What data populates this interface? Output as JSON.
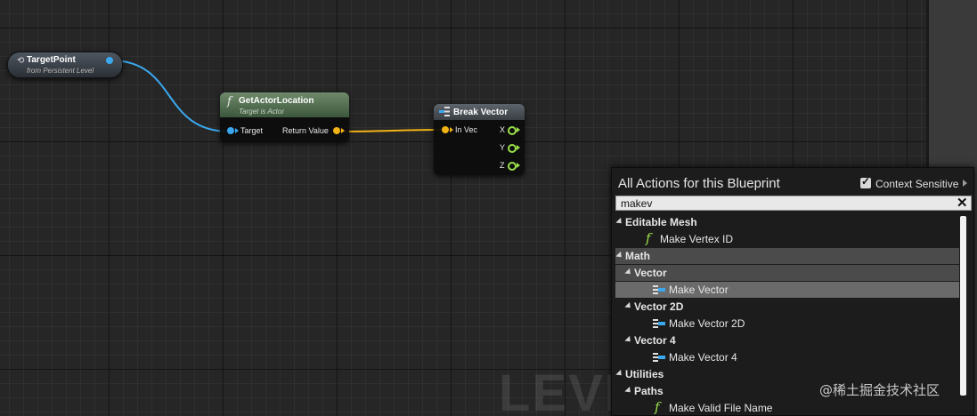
{
  "graph": {
    "watermark": "LEVE",
    "nodes": {
      "target_point": {
        "title": "TargetPoint",
        "subtitle": "from Persistent Level"
      },
      "get_actor_location": {
        "title": "GetActorLocation",
        "subtitle": "Target is Actor",
        "input_pin": "Target",
        "output_pin": "Return Value"
      },
      "break_vector": {
        "title": "Break Vector",
        "input_pin": "In Vec",
        "outputs": [
          "X",
          "Y",
          "Z"
        ]
      }
    }
  },
  "action_menu": {
    "title": "All Actions for this Blueprint",
    "context_sensitive_label": "Context Sensitive",
    "context_sensitive_checked": true,
    "search_value": "makev",
    "items": [
      {
        "kind": "category",
        "level": 0,
        "label": "Editable Mesh"
      },
      {
        "kind": "function",
        "level": 1,
        "label": "Make Vertex ID",
        "icon": "function-icon"
      },
      {
        "kind": "category",
        "level": 0,
        "label": "Math"
      },
      {
        "kind": "category",
        "level": 1,
        "label": "Vector"
      },
      {
        "kind": "function",
        "level": 2,
        "label": "Make Vector",
        "icon": "make-struct-icon",
        "selected": true
      },
      {
        "kind": "category",
        "level": 1,
        "label": "Vector 2D"
      },
      {
        "kind": "function",
        "level": 2,
        "label": "Make Vector 2D",
        "icon": "make-struct-icon"
      },
      {
        "kind": "category",
        "level": 1,
        "label": "Vector 4"
      },
      {
        "kind": "function",
        "level": 2,
        "label": "Make Vector 4",
        "icon": "make-struct-icon"
      },
      {
        "kind": "category",
        "level": 0,
        "label": "Utilities"
      },
      {
        "kind": "category",
        "level": 1,
        "label": "Paths"
      },
      {
        "kind": "function",
        "level": 2,
        "label": "Make Valid File Name",
        "icon": "function-icon"
      }
    ]
  },
  "site_watermark": "@稀土掘金技术社区",
  "colors": {
    "object_pin": "#3aa8ee",
    "vector_pin": "#f1b316",
    "float_pin": "#9ae04a",
    "function_header": "#4c6a4c"
  }
}
